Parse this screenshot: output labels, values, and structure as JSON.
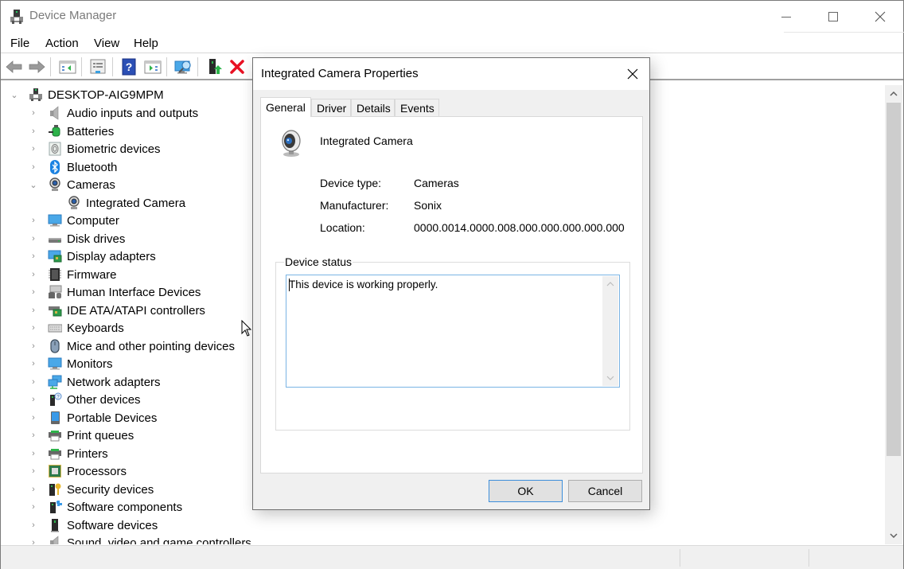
{
  "window": {
    "title": "Device Manager"
  },
  "menu": {
    "items": [
      {
        "label": "File"
      },
      {
        "label": "Action"
      },
      {
        "label": "View"
      },
      {
        "label": "Help"
      }
    ]
  },
  "toolbar": {
    "buttons": [
      {
        "name": "back",
        "icon": "back-arrow-icon"
      },
      {
        "name": "forward",
        "icon": "forward-arrow-icon"
      },
      {
        "name": "show-hide-console-tree",
        "icon": "console-tree-icon"
      },
      {
        "name": "properties",
        "icon": "properties-icon"
      },
      {
        "name": "help",
        "icon": "help-icon"
      },
      {
        "name": "show-hide-action-pane",
        "icon": "action-pane-icon"
      },
      {
        "name": "scan-for-hardware-changes",
        "icon": "scan-monitor-icon"
      },
      {
        "name": "update-driver",
        "icon": "update-driver-icon"
      },
      {
        "name": "uninstall-device",
        "icon": "uninstall-x-icon"
      }
    ]
  },
  "tree": {
    "root": {
      "label": "DESKTOP-AIG9MPM",
      "expanded": true
    },
    "categories": [
      {
        "label": "Audio inputs and outputs",
        "icon": "speaker-icon",
        "expanded": false
      },
      {
        "label": "Batteries",
        "icon": "battery-icon",
        "expanded": false
      },
      {
        "label": "Biometric devices",
        "icon": "fingerprint-icon",
        "expanded": false
      },
      {
        "label": "Bluetooth",
        "icon": "bluetooth-icon",
        "expanded": false
      },
      {
        "label": "Cameras",
        "icon": "camera-icon",
        "expanded": true,
        "children": [
          {
            "label": "Integrated Camera",
            "icon": "camera-icon"
          }
        ]
      },
      {
        "label": "Computer",
        "icon": "computer-icon",
        "expanded": false
      },
      {
        "label": "Disk drives",
        "icon": "disk-drive-icon",
        "expanded": false
      },
      {
        "label": "Display adapters",
        "icon": "display-adapter-icon",
        "expanded": false
      },
      {
        "label": "Firmware",
        "icon": "firmware-chip-icon",
        "expanded": false
      },
      {
        "label": "Human Interface Devices",
        "icon": "hid-icon",
        "expanded": false
      },
      {
        "label": "IDE ATA/ATAPI controllers",
        "icon": "ide-controller-icon",
        "expanded": false
      },
      {
        "label": "Keyboards",
        "icon": "keyboard-icon",
        "expanded": false
      },
      {
        "label": "Mice and other pointing devices",
        "icon": "mouse-icon",
        "expanded": false
      },
      {
        "label": "Monitors",
        "icon": "monitor-icon",
        "expanded": false
      },
      {
        "label": "Network adapters",
        "icon": "network-adapter-icon",
        "expanded": false
      },
      {
        "label": "Other devices",
        "icon": "unknown-device-icon",
        "expanded": false
      },
      {
        "label": "Portable Devices",
        "icon": "portable-device-icon",
        "expanded": false
      },
      {
        "label": "Print queues",
        "icon": "printer-icon",
        "expanded": false
      },
      {
        "label": "Printers",
        "icon": "printer-icon",
        "expanded": false
      },
      {
        "label": "Processors",
        "icon": "processor-icon",
        "expanded": false
      },
      {
        "label": "Security devices",
        "icon": "security-key-icon",
        "expanded": false
      },
      {
        "label": "Software components",
        "icon": "software-component-icon",
        "expanded": false
      },
      {
        "label": "Software devices",
        "icon": "software-device-icon",
        "expanded": false
      },
      {
        "label": "Sound, video and game controllers",
        "icon": "sound-controller-icon",
        "expanded": false
      }
    ]
  },
  "dialog": {
    "title": "Integrated Camera Properties",
    "tabs": [
      {
        "label": "General",
        "active": true
      },
      {
        "label": "Driver",
        "active": false
      },
      {
        "label": "Details",
        "active": false
      },
      {
        "label": "Events",
        "active": false
      }
    ],
    "device_name": "Integrated Camera",
    "properties": [
      {
        "label": "Device type:",
        "value": "Cameras"
      },
      {
        "label": "Manufacturer:",
        "value": "Sonix"
      },
      {
        "label": "Location:",
        "value": "0000.0014.0000.008.000.000.000.000.000"
      }
    ],
    "status_group_label": "Device status",
    "status_text": "This device is working properly.",
    "ok_label": "OK",
    "cancel_label": "Cancel"
  },
  "colors": {
    "accent_blue": "#3c8edb",
    "uninstall_red": "#e81123",
    "update_green": "#2db34a"
  }
}
